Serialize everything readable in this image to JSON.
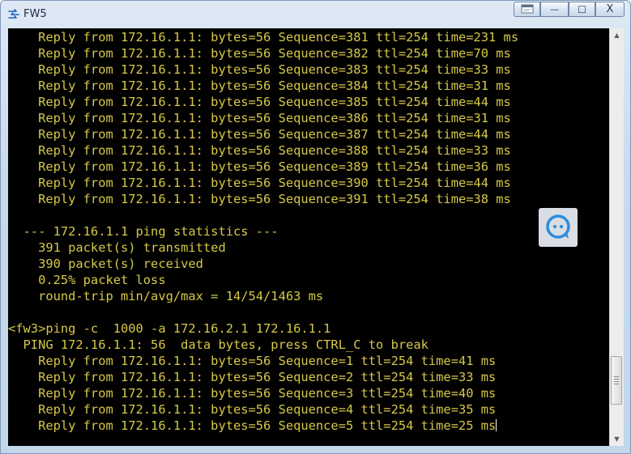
{
  "window": {
    "title": "FW5",
    "app_icon": "network-device-icon",
    "controls": {
      "restore_icon": "restore-icon",
      "minimize_label": "—",
      "maximize_label": "☐",
      "close_label": "X"
    }
  },
  "colors": {
    "terminal_bg": "#000000",
    "terminal_text": "#d6c848",
    "titlebar": "#c9d9ec",
    "chat_accent": "#2a8de0"
  },
  "terminal": {
    "lines": [
      "    Reply from 172.16.1.1: bytes=56 Sequence=381 ttl=254 time=231 ms",
      "    Reply from 172.16.1.1: bytes=56 Sequence=382 ttl=254 time=70 ms",
      "    Reply from 172.16.1.1: bytes=56 Sequence=383 ttl=254 time=33 ms",
      "    Reply from 172.16.1.1: bytes=56 Sequence=384 ttl=254 time=31 ms",
      "    Reply from 172.16.1.1: bytes=56 Sequence=385 ttl=254 time=44 ms",
      "    Reply from 172.16.1.1: bytes=56 Sequence=386 ttl=254 time=31 ms",
      "    Reply from 172.16.1.1: bytes=56 Sequence=387 ttl=254 time=44 ms",
      "    Reply from 172.16.1.1: bytes=56 Sequence=388 ttl=254 time=33 ms",
      "    Reply from 172.16.1.1: bytes=56 Sequence=389 ttl=254 time=36 ms",
      "    Reply from 172.16.1.1: bytes=56 Sequence=390 ttl=254 time=44 ms",
      "    Reply from 172.16.1.1: bytes=56 Sequence=391 ttl=254 time=38 ms",
      "",
      "  --- 172.16.1.1 ping statistics ---",
      "    391 packet(s) transmitted",
      "    390 packet(s) received",
      "    0.25% packet loss",
      "    round-trip min/avg/max = 14/54/1463 ms",
      "",
      "<fw3>ping -c  1000 -a 172.16.2.1 172.16.1.1",
      "  PING 172.16.1.1: 56  data bytes, press CTRL_C to break",
      "    Reply from 172.16.1.1: bytes=56 Sequence=1 ttl=254 time=41 ms",
      "    Reply from 172.16.1.1: bytes=56 Sequence=2 ttl=254 time=33 ms",
      "    Reply from 172.16.1.1: bytes=56 Sequence=3 ttl=254 time=40 ms",
      "    Reply from 172.16.1.1: bytes=56 Sequence=4 ttl=254 time=35 ms",
      "    Reply from 172.16.1.1: bytes=56 Sequence=5 ttl=254 time=25 ms"
    ]
  },
  "scrollbar": {
    "position": 0.92
  },
  "chat_widget": {
    "icon": "chat-bubble-icon"
  }
}
